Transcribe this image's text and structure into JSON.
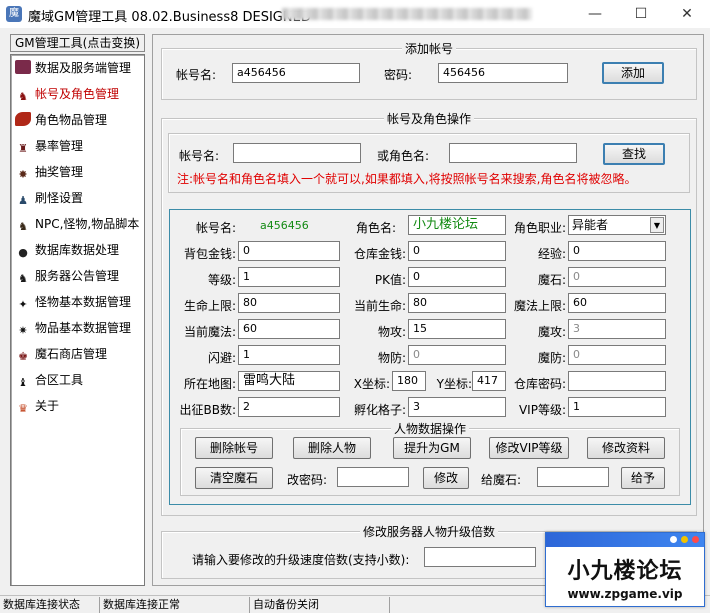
{
  "window": {
    "icon": "game-app-icon",
    "title": "魔域GM管理工具 08.02.Business8 DESIGNED",
    "controls": {
      "minimize": "—",
      "maximize": "☐",
      "close": "✕"
    }
  },
  "sidebar": {
    "header": "GM管理工具(点击变换)",
    "items": [
      {
        "label": "数据及服务端管理",
        "icon": "book-icon"
      },
      {
        "label": "帐号及角色管理",
        "icon": "figure-icon",
        "active": true
      },
      {
        "label": "角色物品管理",
        "icon": "feather-icon"
      },
      {
        "label": "暴率管理",
        "icon": "creature-icon"
      },
      {
        "label": "抽奖管理",
        "icon": "claw-icon"
      },
      {
        "label": "刷怪设置",
        "icon": "mech-icon"
      },
      {
        "label": "NPC,怪物,物品脚本",
        "icon": "wolf-icon"
      },
      {
        "label": "数据库数据处理",
        "icon": "bird-icon"
      },
      {
        "label": "服务器公告管理",
        "icon": "horse-icon"
      },
      {
        "label": "怪物基本数据管理",
        "icon": "raven-icon"
      },
      {
        "label": "物品基本数据管理",
        "icon": "dragon-icon"
      },
      {
        "label": "魔石商店管理",
        "icon": "knight-icon"
      },
      {
        "label": "合区工具",
        "icon": "beast-icon"
      },
      {
        "label": "关于",
        "icon": "cat-icon"
      }
    ]
  },
  "add_account": {
    "title": "添加帐号",
    "account_label": "帐号名:",
    "account_value": "a456456",
    "password_label": "密码:",
    "password_value": "456456",
    "add_button": "添加"
  },
  "account_ops": {
    "title": "帐号及角色操作",
    "search": {
      "account_label": "帐号名:",
      "account_value": "",
      "role_label": "或角色名:",
      "role_value": "",
      "search_button": "查找",
      "note": "注:帐号名和角色名填入一个就可以,如果都填入,将按照帐号名来搜索,角色名将被忽略。"
    },
    "info": {
      "account_label": "帐号名:",
      "account_value": "a456456",
      "role_label": "角色名:",
      "role_value": "小九楼论坛",
      "job_label": "角色职业:",
      "job_value": "异能者",
      "bag_money_label": "背包金钱:",
      "bag_money": "0",
      "store_money_label": "仓库金钱:",
      "store_money": "0",
      "exp_label": "经验:",
      "exp": "0",
      "level_label": "等级:",
      "level": "1",
      "pk_label": "PK值:",
      "pk": "0",
      "magic_stone_label": "魔石:",
      "magic_stone": "0",
      "hp_max_label": "生命上限:",
      "hp_max": "80",
      "hp_label": "当前生命:",
      "hp": "80",
      "mp_max_label": "魔法上限:",
      "mp_max": "60",
      "mp_label": "当前魔法:",
      "mp": "60",
      "patk_label": "物攻:",
      "patk": "15",
      "matk_label": "魔攻:",
      "matk": "3",
      "dodge_label": "闪避:",
      "dodge": "1",
      "pdef_label": "物防:",
      "pdef": "0",
      "mdef_label": "魔防:",
      "mdef": "0",
      "map_label": "所在地图:",
      "map": "雷鸣大陆",
      "x_label": "X坐标:",
      "x": "180",
      "y_label": "Y坐标:",
      "y": "417",
      "store_pwd_label": "仓库密码:",
      "store_pwd": "",
      "bb_label": "出征BB数:",
      "bb": "2",
      "hatch_label": "孵化格子:",
      "hatch": "3",
      "vip_label": "VIP等级:",
      "vip": "1"
    },
    "data_ops": {
      "title": "人物数据操作",
      "delete_account": "删除帐号",
      "delete_role": "删除人物",
      "make_gm": "提升为GM",
      "modify_vip": "修改VIP等级",
      "modify_info": "修改资料",
      "clear_stone": "清空魔石",
      "change_pwd_label": "改密码:",
      "change_pwd_value": "",
      "modify_button": "修改",
      "give_stone_label": "给魔石:",
      "give_stone_value": "",
      "give_button": "给予"
    }
  },
  "server_rate": {
    "title": "修改服务器人物升级倍数",
    "prompt": "请输入要修改的升级速度倍数(支持小数):",
    "value": ""
  },
  "statusbar": {
    "db_state_label": "数据库连接状态",
    "db_state_value": "数据库连接正常",
    "backup": "自动备份关闭"
  },
  "watermark": {
    "title": "小九楼论坛",
    "url": "www.zpgame.vip",
    "dot_colors": [
      "#ffffff",
      "#f2c200",
      "#ff4a4a"
    ]
  }
}
